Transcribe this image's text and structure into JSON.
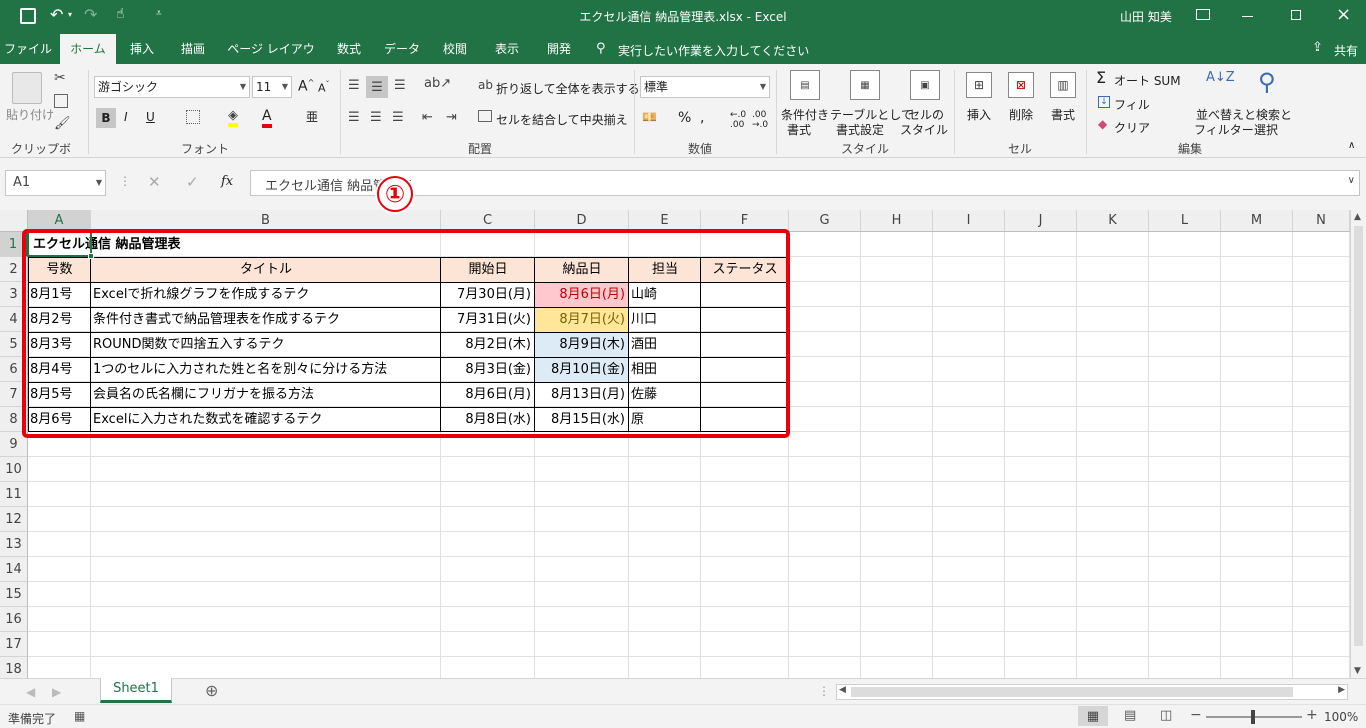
{
  "titlebar": {
    "doc_title": "エクセル通信 納品管理表.xlsx - Excel",
    "user": "山田 知美"
  },
  "tabs": [
    "ファイル",
    "ホーム",
    "挿入",
    "描画",
    "ページ レイアウト",
    "数式",
    "データ",
    "校閲",
    "表示",
    "開発"
  ],
  "tell_me": "実行したい作業を入力してください",
  "share_label": "共有",
  "ribbon": {
    "clipboard": {
      "paste": "貼り付け",
      "group": "クリップボード"
    },
    "font": {
      "name": "游ゴシック",
      "size": "11",
      "group": "フォント",
      "bold": "B",
      "italic": "I",
      "underline": "U"
    },
    "alignment": {
      "wrap": "折り返して全体を表示する",
      "merge": "セルを結合して中央揃え",
      "group": "配置"
    },
    "number": {
      "format": "標準",
      "group": "数値"
    },
    "styles": {
      "conditional": [
        "条件付き",
        "書式"
      ],
      "table": [
        "テーブルとして",
        "書式設定"
      ],
      "cell": [
        "セルの",
        "スタイル"
      ],
      "group": "スタイル"
    },
    "cells": {
      "insert": "挿入",
      "delete": "削除",
      "format": "書式",
      "group": "セル"
    },
    "editing": {
      "autosum": "オート SUM",
      "fill": "フィル",
      "clear": "クリア",
      "sort": [
        "並べ替えと",
        "フィルター"
      ],
      "find": [
        "検索と",
        "選択"
      ],
      "group": "編集"
    }
  },
  "formula_bar": {
    "name_box": "A1",
    "content": "エクセル通信 納品管理表",
    "fx": "fx"
  },
  "callout": "①",
  "columns": [
    "A",
    "B",
    "C",
    "D",
    "E",
    "F",
    "G",
    "H",
    "I",
    "J",
    "K",
    "L",
    "M",
    "N"
  ],
  "rows": [
    "1",
    "2",
    "3",
    "4",
    "5",
    "6",
    "7",
    "8",
    "9",
    "10",
    "11",
    "12",
    "13",
    "14",
    "15",
    "16",
    "17",
    "18"
  ],
  "sheet": {
    "title": "エクセル通信 納品管理表",
    "headers": [
      "号数",
      "タイトル",
      "開始日",
      "納品日",
      "担当",
      "ステータス"
    ],
    "records": [
      [
        "8月1号",
        "Excelで折れ線グラフを作成するテク",
        "7月30日(月)",
        "8月6日(月)",
        "山崎",
        ""
      ],
      [
        "8月2号",
        "条件付き書式で納品管理表を作成するテク",
        "7月31日(火)",
        "8月7日(火)",
        "川口",
        ""
      ],
      [
        "8月3号",
        "ROUND関数で四捨五入するテク",
        "8月2日(木)",
        "8月9日(木)",
        "酒田",
        ""
      ],
      [
        "8月4号",
        "1つのセルに入力された姓と名を別々に分ける方法",
        "8月3日(金)",
        "8月10日(金)",
        "相田",
        ""
      ],
      [
        "8月5号",
        "会員名の氏名欄にフリガナを振る方法",
        "8月6日(月)",
        "8月13日(月)",
        "佐藤",
        ""
      ],
      [
        "8月6号",
        "Excelに入力された数式を確認するテク",
        "8月8日(水)",
        "8月15日(水)",
        "原",
        ""
      ]
    ],
    "d_fills": [
      "#ffc7ce",
      "#ffe699",
      "#ddebf7",
      "#ddebf7",
      "",
      ""
    ],
    "d_text_colors": [
      "#c00000",
      "#7f6000",
      "#000000",
      "#000000",
      "#000000",
      "#000000"
    ]
  },
  "sheet_tab": "Sheet1",
  "status": {
    "ready": "準備完了",
    "zoom": "100%"
  },
  "colors": {
    "excel_green": "#217346",
    "highlight_red": "#e8000b",
    "header_fill": "#fce4d6"
  }
}
